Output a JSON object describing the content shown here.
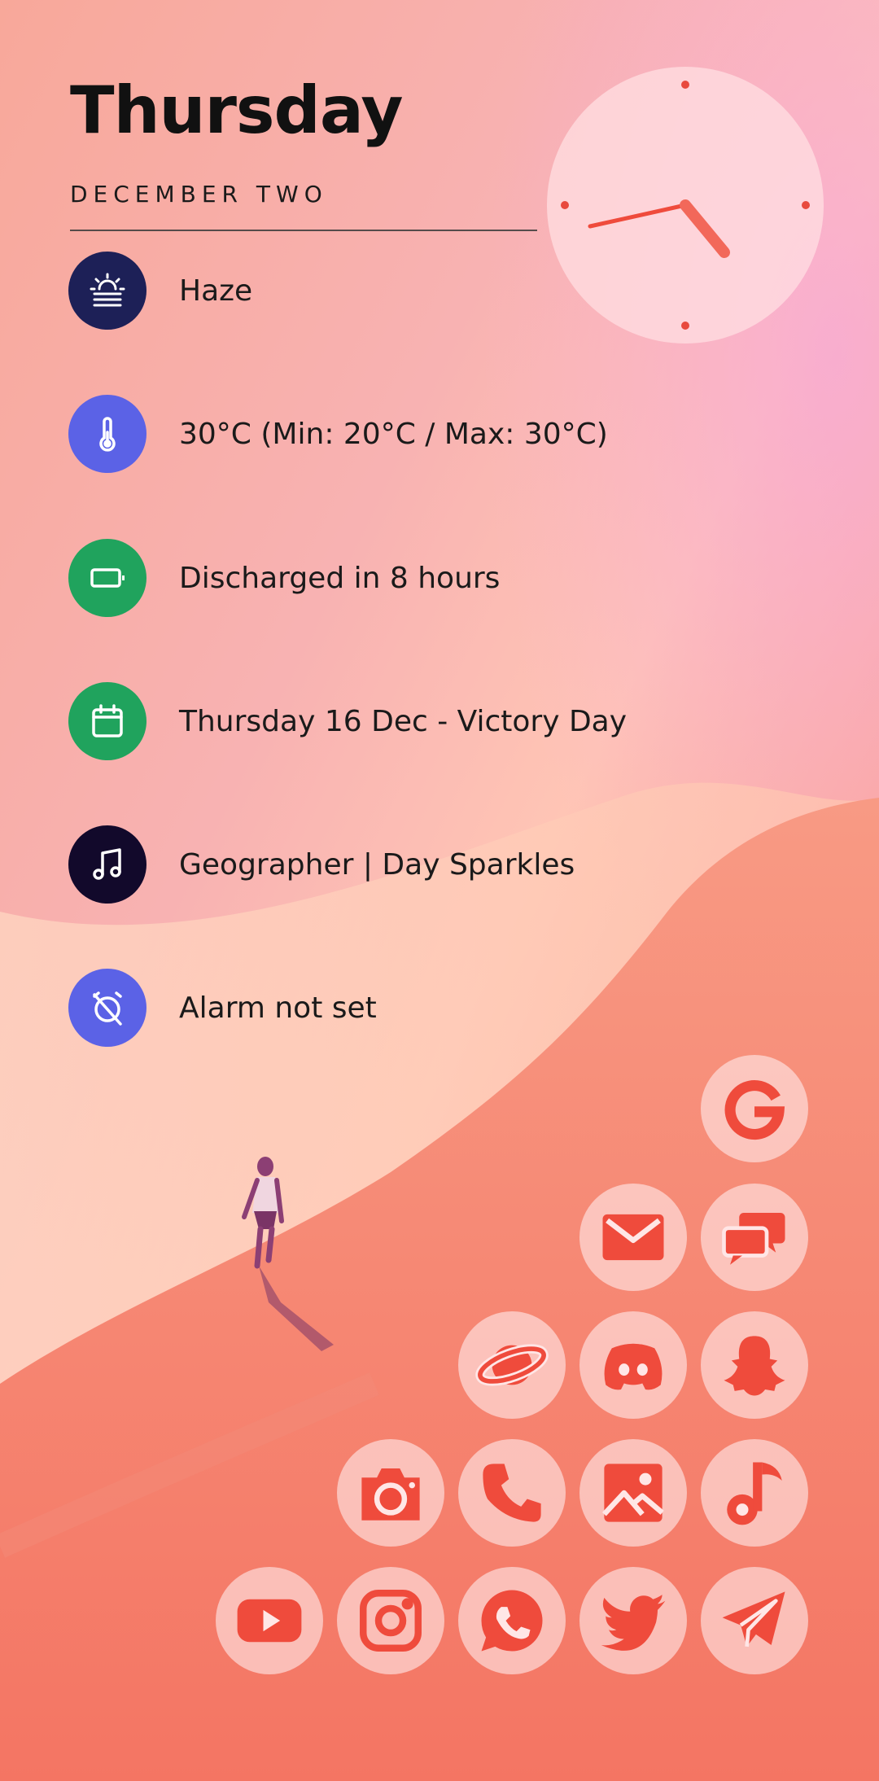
{
  "header": {
    "day": "Thursday",
    "date": "DECEMBER TWO"
  },
  "widgets": [
    {
      "icon": "weather-haze-icon",
      "color": "#1d2057",
      "text": "Haze"
    },
    {
      "icon": "thermometer-icon",
      "color": "#5b62e6",
      "text": "30°C (Min: 20°C / Max: 30°C)"
    },
    {
      "icon": "battery-icon",
      "color": "#20a35d",
      "text": "Discharged in 8 hours"
    },
    {
      "icon": "calendar-icon",
      "color": "#20a35d",
      "text": "Thursday 16 Dec - Victory Day"
    },
    {
      "icon": "music-note-icon",
      "color": "#12092b",
      "text": "Geographer | Day Sparkles"
    },
    {
      "icon": "alarm-off-icon",
      "color": "#5b62e6",
      "text": "Alarm not set"
    }
  ],
  "apps": [
    "google",
    "email",
    "messages",
    "browser",
    "discord",
    "snapchat",
    "camera",
    "phone",
    "gallery",
    "music",
    "youtube",
    "instagram",
    "whatsapp",
    "twitter",
    "telegram"
  ],
  "colors": {
    "accent": "#ef4b3c",
    "icon_bg": "#ffe8e8"
  }
}
